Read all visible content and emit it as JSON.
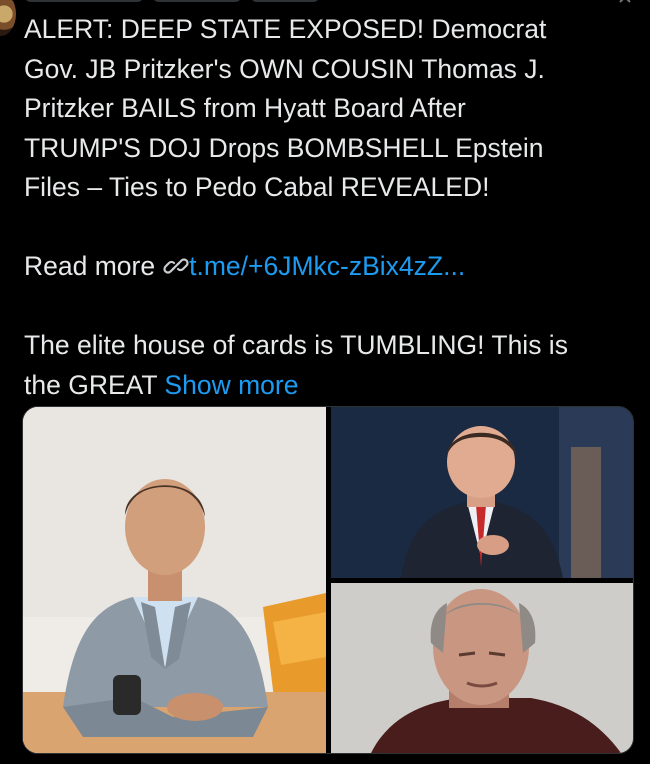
{
  "tweet": {
    "line1": "ALERT: DEEP STATE EXPOSED! Democrat",
    "line2": "Gov. JB Pritzker's OWN COUSIN Thomas J.",
    "line3": "Pritzker BAILS from Hyatt Board After",
    "line4": "TRUMP'S DOJ Drops BOMBSHELL Epstein",
    "line5": "Files – Ties to Pedo Cabal REVEALED!",
    "read_more_label": "Read more",
    "link_icon": "link-chain-icon",
    "link_text": "t.me/+6JMkc-zBix4zZ...",
    "line6": "The elite house of cards is TUMBLING! This is",
    "line7": "the GREAT",
    "show_more": "Show more"
  },
  "colors": {
    "background": "#000000",
    "text": "#e7e9ea",
    "link": "#1d9bf0",
    "border": "#2f3336"
  },
  "media": {
    "photos": [
      "smiling man in grey blazer seated at table",
      "man in dark suit and red tie against navy backdrop",
      "man with grey hair looking down"
    ]
  }
}
